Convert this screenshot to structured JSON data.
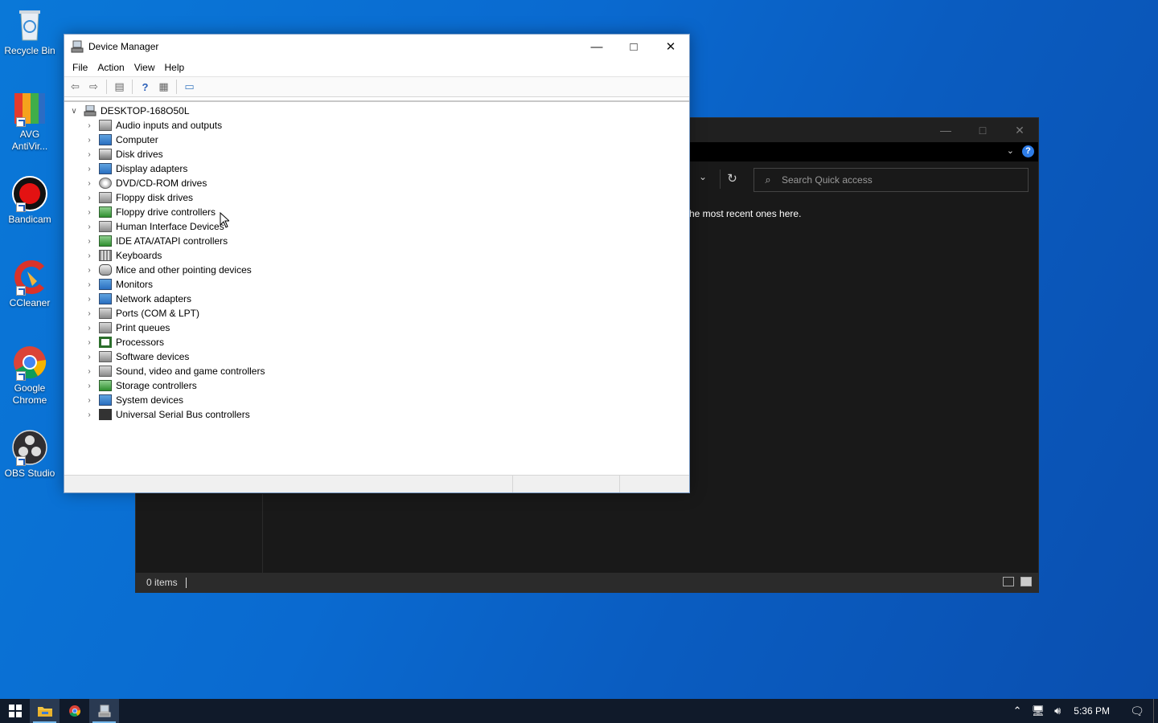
{
  "desktop": {
    "icons": [
      {
        "label": "Recycle Bin",
        "icon": "recycle-bin-icon"
      },
      {
        "label": "AVG AntiVir...",
        "icon": "avg-icon"
      },
      {
        "label": "Bandicam",
        "icon": "bandicam-icon"
      },
      {
        "label": "CCleaner",
        "icon": "ccleaner-icon"
      },
      {
        "label": "Google Chrome",
        "icon": "chrome-icon"
      },
      {
        "label": "OBS Studio",
        "icon": "obs-icon"
      }
    ]
  },
  "explorer": {
    "search_placeholder": "Search Quick access",
    "message": "he most recent ones here.",
    "status": "0 items"
  },
  "device_manager": {
    "title": "Device Manager",
    "menu": [
      "File",
      "Action",
      "View",
      "Help"
    ],
    "root": "DESKTOP-168O50L",
    "categories": [
      {
        "label": "Audio inputs and outputs",
        "icon": "speaker-icon"
      },
      {
        "label": "Computer",
        "icon": "monitor-icon"
      },
      {
        "label": "Disk drives",
        "icon": "disk-drive-icon"
      },
      {
        "label": "Display adapters",
        "icon": "display-adapter-icon"
      },
      {
        "label": "DVD/CD-ROM drives",
        "icon": "dvd-icon"
      },
      {
        "label": "Floppy disk drives",
        "icon": "floppy-icon"
      },
      {
        "label": "Floppy drive controllers",
        "icon": "controller-icon"
      },
      {
        "label": "Human Interface Devices",
        "icon": "hid-icon"
      },
      {
        "label": "IDE ATA/ATAPI controllers",
        "icon": "ide-icon"
      },
      {
        "label": "Keyboards",
        "icon": "keyboard-icon"
      },
      {
        "label": "Mice and other pointing devices",
        "icon": "mouse-icon"
      },
      {
        "label": "Monitors",
        "icon": "monitor-icon"
      },
      {
        "label": "Network adapters",
        "icon": "network-icon"
      },
      {
        "label": "Ports (COM & LPT)",
        "icon": "port-icon"
      },
      {
        "label": "Print queues",
        "icon": "printer-icon"
      },
      {
        "label": "Processors",
        "icon": "processor-icon"
      },
      {
        "label": "Software devices",
        "icon": "software-device-icon"
      },
      {
        "label": "Sound, video and game controllers",
        "icon": "speaker-icon"
      },
      {
        "label": "Storage controllers",
        "icon": "storage-icon"
      },
      {
        "label": "System devices",
        "icon": "system-icon"
      },
      {
        "label": "Universal Serial Bus controllers",
        "icon": "usb-icon"
      }
    ]
  },
  "taskbar": {
    "clock": "5:36 PM"
  }
}
